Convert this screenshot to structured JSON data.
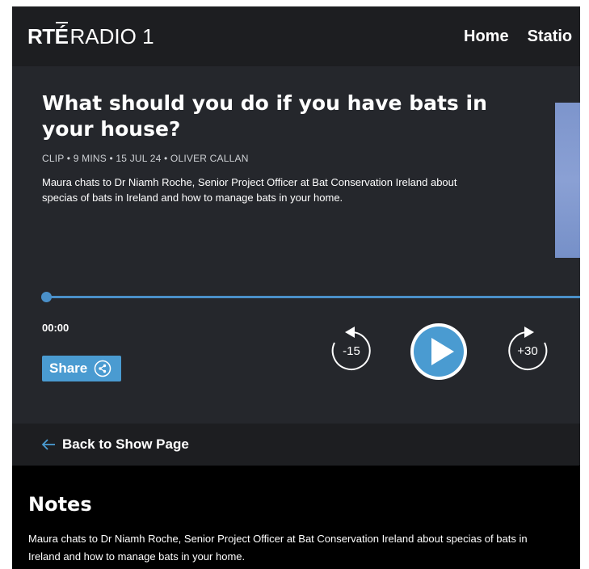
{
  "header": {
    "logo_brand": "RT",
    "logo_e": "É",
    "logo_station": "RADIO 1",
    "nav": [
      {
        "label": "Home"
      },
      {
        "label": "Statio"
      }
    ]
  },
  "episode": {
    "title": "What should you do if you have bats in your house?",
    "meta": "CLIP • 9 MINS • 15 JUL 24 • OLIVER CALLAN",
    "description": "Maura chats to Dr Niamh Roche, Senior Project Officer at Bat Conservation Ireland about specias of bats in Ireland and how to manage bats in your home."
  },
  "player": {
    "current_time": "00:00",
    "progress": 0,
    "rewind_label": "-15",
    "forward_label": "+30",
    "share_label": "Share"
  },
  "back": {
    "label": "Back to Show Page"
  },
  "notes": {
    "title": "Notes",
    "body": "Maura chats to Dr Niamh Roche, Senior Project Officer at Bat Conservation Ireland about specias of bats in Ireland and how to manage bats in your home."
  },
  "colors": {
    "accent": "#4a9bd1",
    "header_bg": "#1d1e21",
    "panel_bg": "#25272c",
    "page_bg": "#000000"
  },
  "icons": {
    "share": "share-icon",
    "play": "play-icon",
    "rewind": "rewind-15-icon",
    "forward": "forward-30-icon",
    "back": "arrow-left-icon"
  }
}
